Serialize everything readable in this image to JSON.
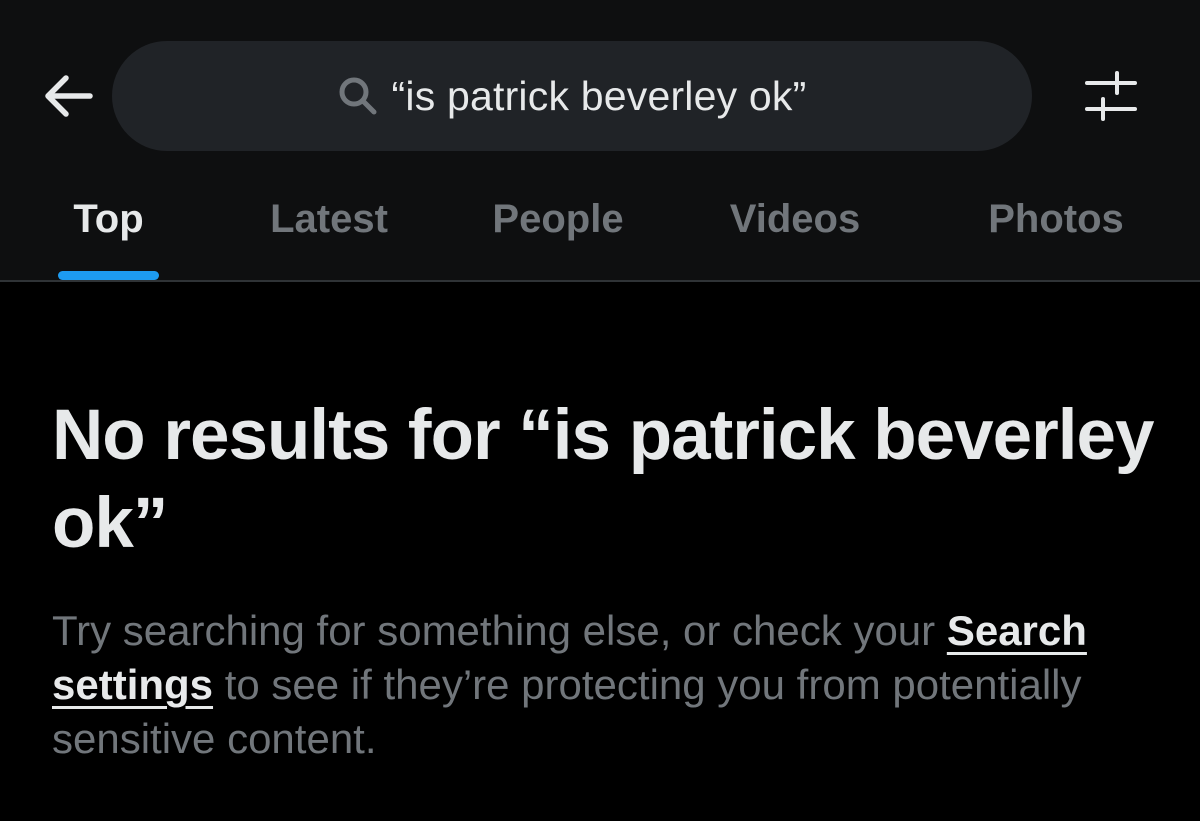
{
  "search": {
    "query": "“is patrick beverley ok”"
  },
  "icons": {
    "back": "arrow-left-icon",
    "search": "magnifier-icon",
    "filter": "sliders-icon"
  },
  "tabs": [
    {
      "label": "Top",
      "active": true
    },
    {
      "label": "Latest",
      "active": false
    },
    {
      "label": "People",
      "active": false
    },
    {
      "label": "Videos",
      "active": false
    },
    {
      "label": "Photos",
      "active": false
    }
  ],
  "empty_state": {
    "title": "No results for “is patrick beverley ok”",
    "body_before": "Try searching for something else, or check your ",
    "link_label": "Search settings",
    "body_after": " to see if they’re protecting you from potentially sensitive content."
  },
  "colors": {
    "background": "#000000",
    "header": "#0e0f10",
    "search_pill": "#202327",
    "accent": "#1d9bf0",
    "primary_text": "#e7e9ea",
    "secondary_text": "#71767b"
  }
}
